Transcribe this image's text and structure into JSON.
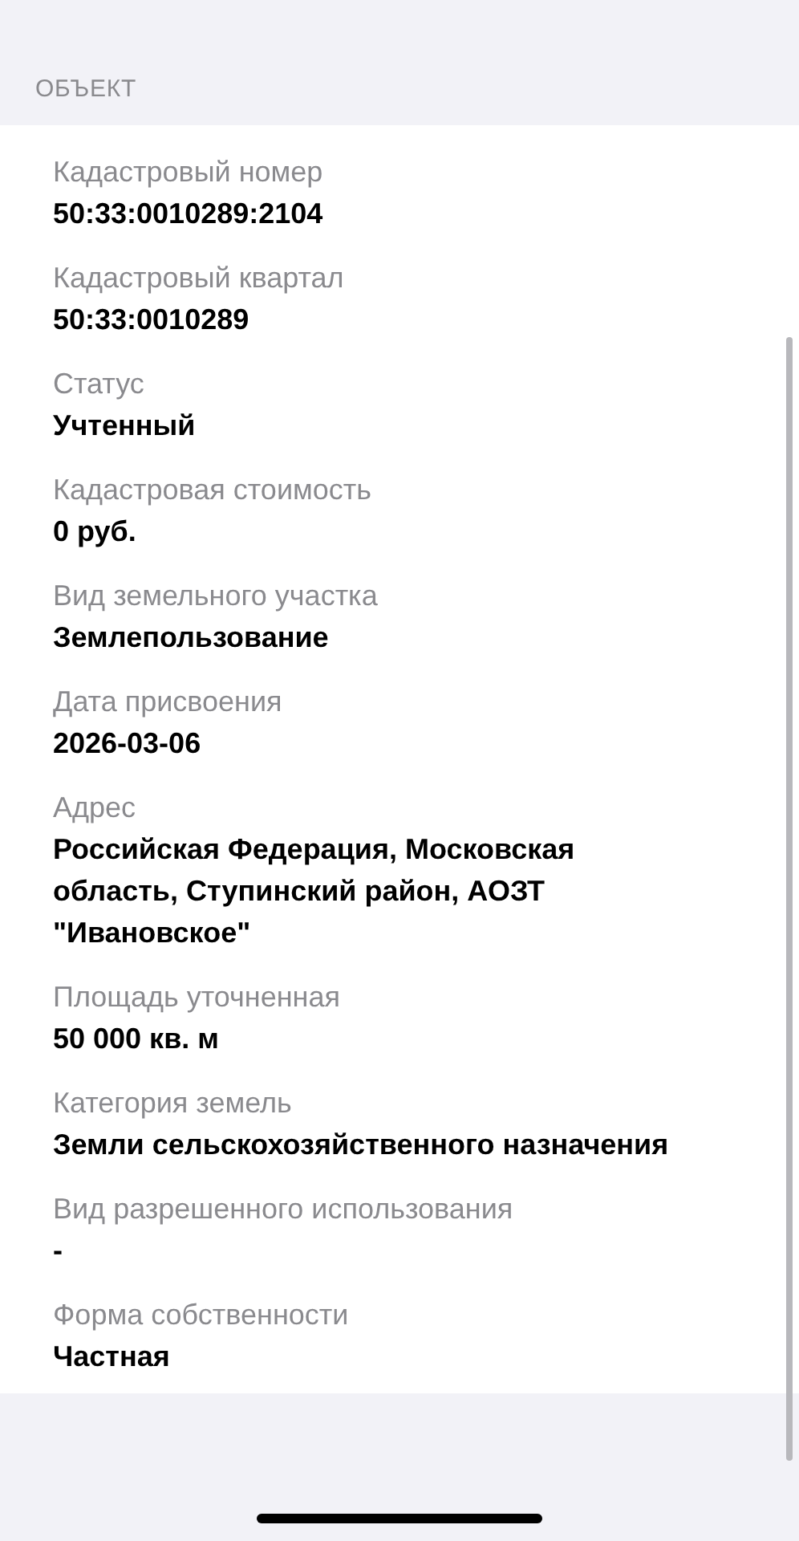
{
  "section": {
    "title": "ОБЪЕКТ"
  },
  "fields": [
    {
      "label": "Кадастровый номер",
      "value": "50:33:0010289:2104"
    },
    {
      "label": "Кадастровый квартал",
      "value": "50:33:0010289"
    },
    {
      "label": "Статус",
      "value": "Учтенный"
    },
    {
      "label": "Кадастровая стоимость",
      "value": "0 руб."
    },
    {
      "label": "Вид земельного участка",
      "value": "Землепользование"
    },
    {
      "label": "Дата присвоения",
      "value": "2026-03-06"
    },
    {
      "label": "Адрес",
      "value": "Российская Федерация, Московская область, Ступинский район, АОЗТ \"Ивановское\""
    },
    {
      "label": "Площадь уточненная",
      "value": "50 000 кв. м"
    },
    {
      "label": "Категория земель",
      "value": "Земли сельскохозяйственного назначения"
    },
    {
      "label": "Вид разрешенного использования",
      "value": "-"
    },
    {
      "label": "Форма собственности",
      "value": "Частная"
    }
  ]
}
